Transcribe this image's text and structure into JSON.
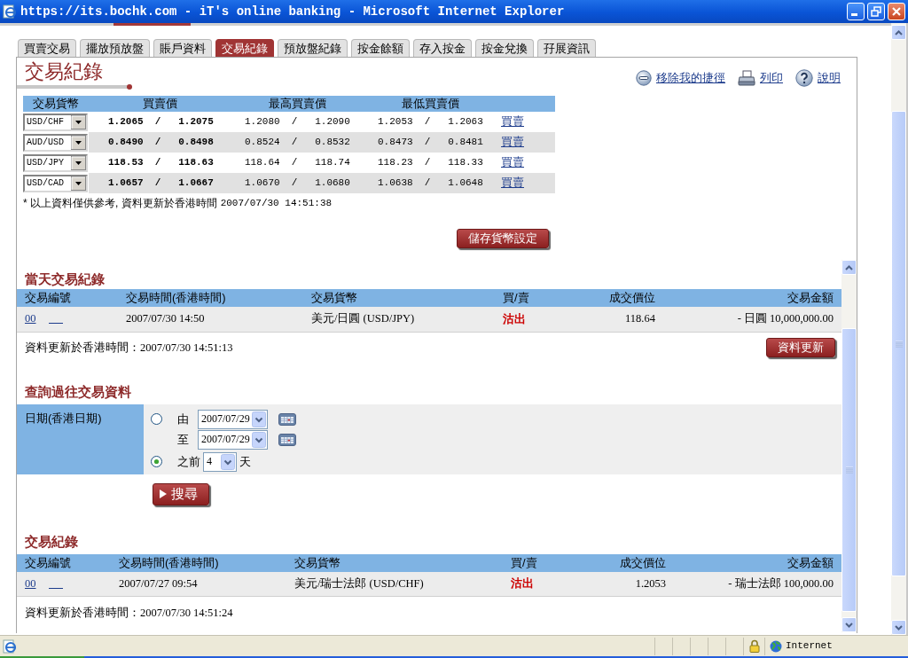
{
  "window": {
    "title": "https://its.bochk.com - iT's online banking - Microsoft Internet Explorer"
  },
  "tabs": [
    {
      "label": "買賣交易",
      "selected": false
    },
    {
      "label": "擺放預放盤",
      "selected": false
    },
    {
      "label": "賬戶資料",
      "selected": false
    },
    {
      "label": "交易紀錄",
      "selected": true
    },
    {
      "label": "預放盤紀錄",
      "selected": false
    },
    {
      "label": "按金餘額",
      "selected": false
    },
    {
      "label": "存入按金",
      "selected": false
    },
    {
      "label": "按金兌換",
      "selected": false
    },
    {
      "label": "孖展資訊",
      "selected": false
    }
  ],
  "page_title": "交易紀錄",
  "actions": [
    {
      "kind": "remove",
      "label": "移除我的捷徑"
    },
    {
      "kind": "print",
      "label": "列印"
    },
    {
      "kind": "help",
      "label": "說明"
    }
  ],
  "rates": {
    "columns": [
      "交易貨幣",
      "買賣價",
      "最高買賣價",
      "最低買賣價"
    ],
    "rows": [
      {
        "pair": "USD/CHF",
        "price": "1.2065  /   1.2075",
        "high": "1.2080  /   1.2090",
        "low": "1.2053  /   1.2063",
        "action": "買賣"
      },
      {
        "pair": "AUD/USD",
        "price": "0.8490  /   0.8498",
        "high": "0.8524  /   0.8532",
        "low": "0.8473  /   0.8481",
        "action": "買賣"
      },
      {
        "pair": "USD/JPY",
        "price": "118.53  /   118.63",
        "high": "118.64  /   118.74",
        "low": "118.23  /   118.33",
        "action": "買賣"
      },
      {
        "pair": "USD/CAD",
        "price": "1.0657  /   1.0667",
        "high": "1.0670  /   1.0680",
        "low": "1.0638  /   1.0648",
        "action": "買賣"
      }
    ]
  },
  "rates_note": {
    "text": "* 以上資料僅供參考, 資料更新於香港時間",
    "time": "2007/07/30 14:51:38"
  },
  "save_button": "儲存貨幣設定",
  "today": {
    "title": "當天交易紀錄",
    "columns": [
      "交易編號",
      "交易時間(香港時間)",
      "交易貨幣",
      "買/賣",
      "成交價位",
      "交易金額"
    ],
    "rows": [
      {
        "id": "00",
        "time": "2007/07/30 14:50",
        "currency": "美元/日圓 (USD/JPY)",
        "side": "沽出",
        "price": "118.64",
        "amount": "- 日圓 10,000,000.00"
      }
    ],
    "updated": "資料更新於香港時間：2007/07/30 14:51:13",
    "refresh_button": "資料更新"
  },
  "query": {
    "title": "查詢過往交易資料",
    "label": "日期(香港日期)",
    "options": [
      {
        "kind": "range",
        "selected": false,
        "from_label": "由",
        "from": "2007/07/29",
        "to_label": "至",
        "to": "2007/07/29"
      },
      {
        "kind": "days",
        "selected": true,
        "prefix": "之前",
        "value": "4",
        "suffix": "天"
      }
    ],
    "search_button": "搜尋"
  },
  "history": {
    "title": "交易紀錄",
    "columns": [
      "交易編號",
      "交易時間(香港時間)",
      "交易貨幣",
      "買/賣",
      "成交價位",
      "交易金額"
    ],
    "rows": [
      {
        "id": "00",
        "time": "2007/07/27 09:54",
        "currency": "美元/瑞士法郎 (USD/CHF)",
        "side": "沽出",
        "price": "1.2053",
        "amount": "- 瑞士法郎 100,000.00"
      }
    ],
    "updated": "資料更新於香港時間：2007/07/30 14:51:24"
  },
  "status_bar": {
    "zone": "Internet"
  }
}
